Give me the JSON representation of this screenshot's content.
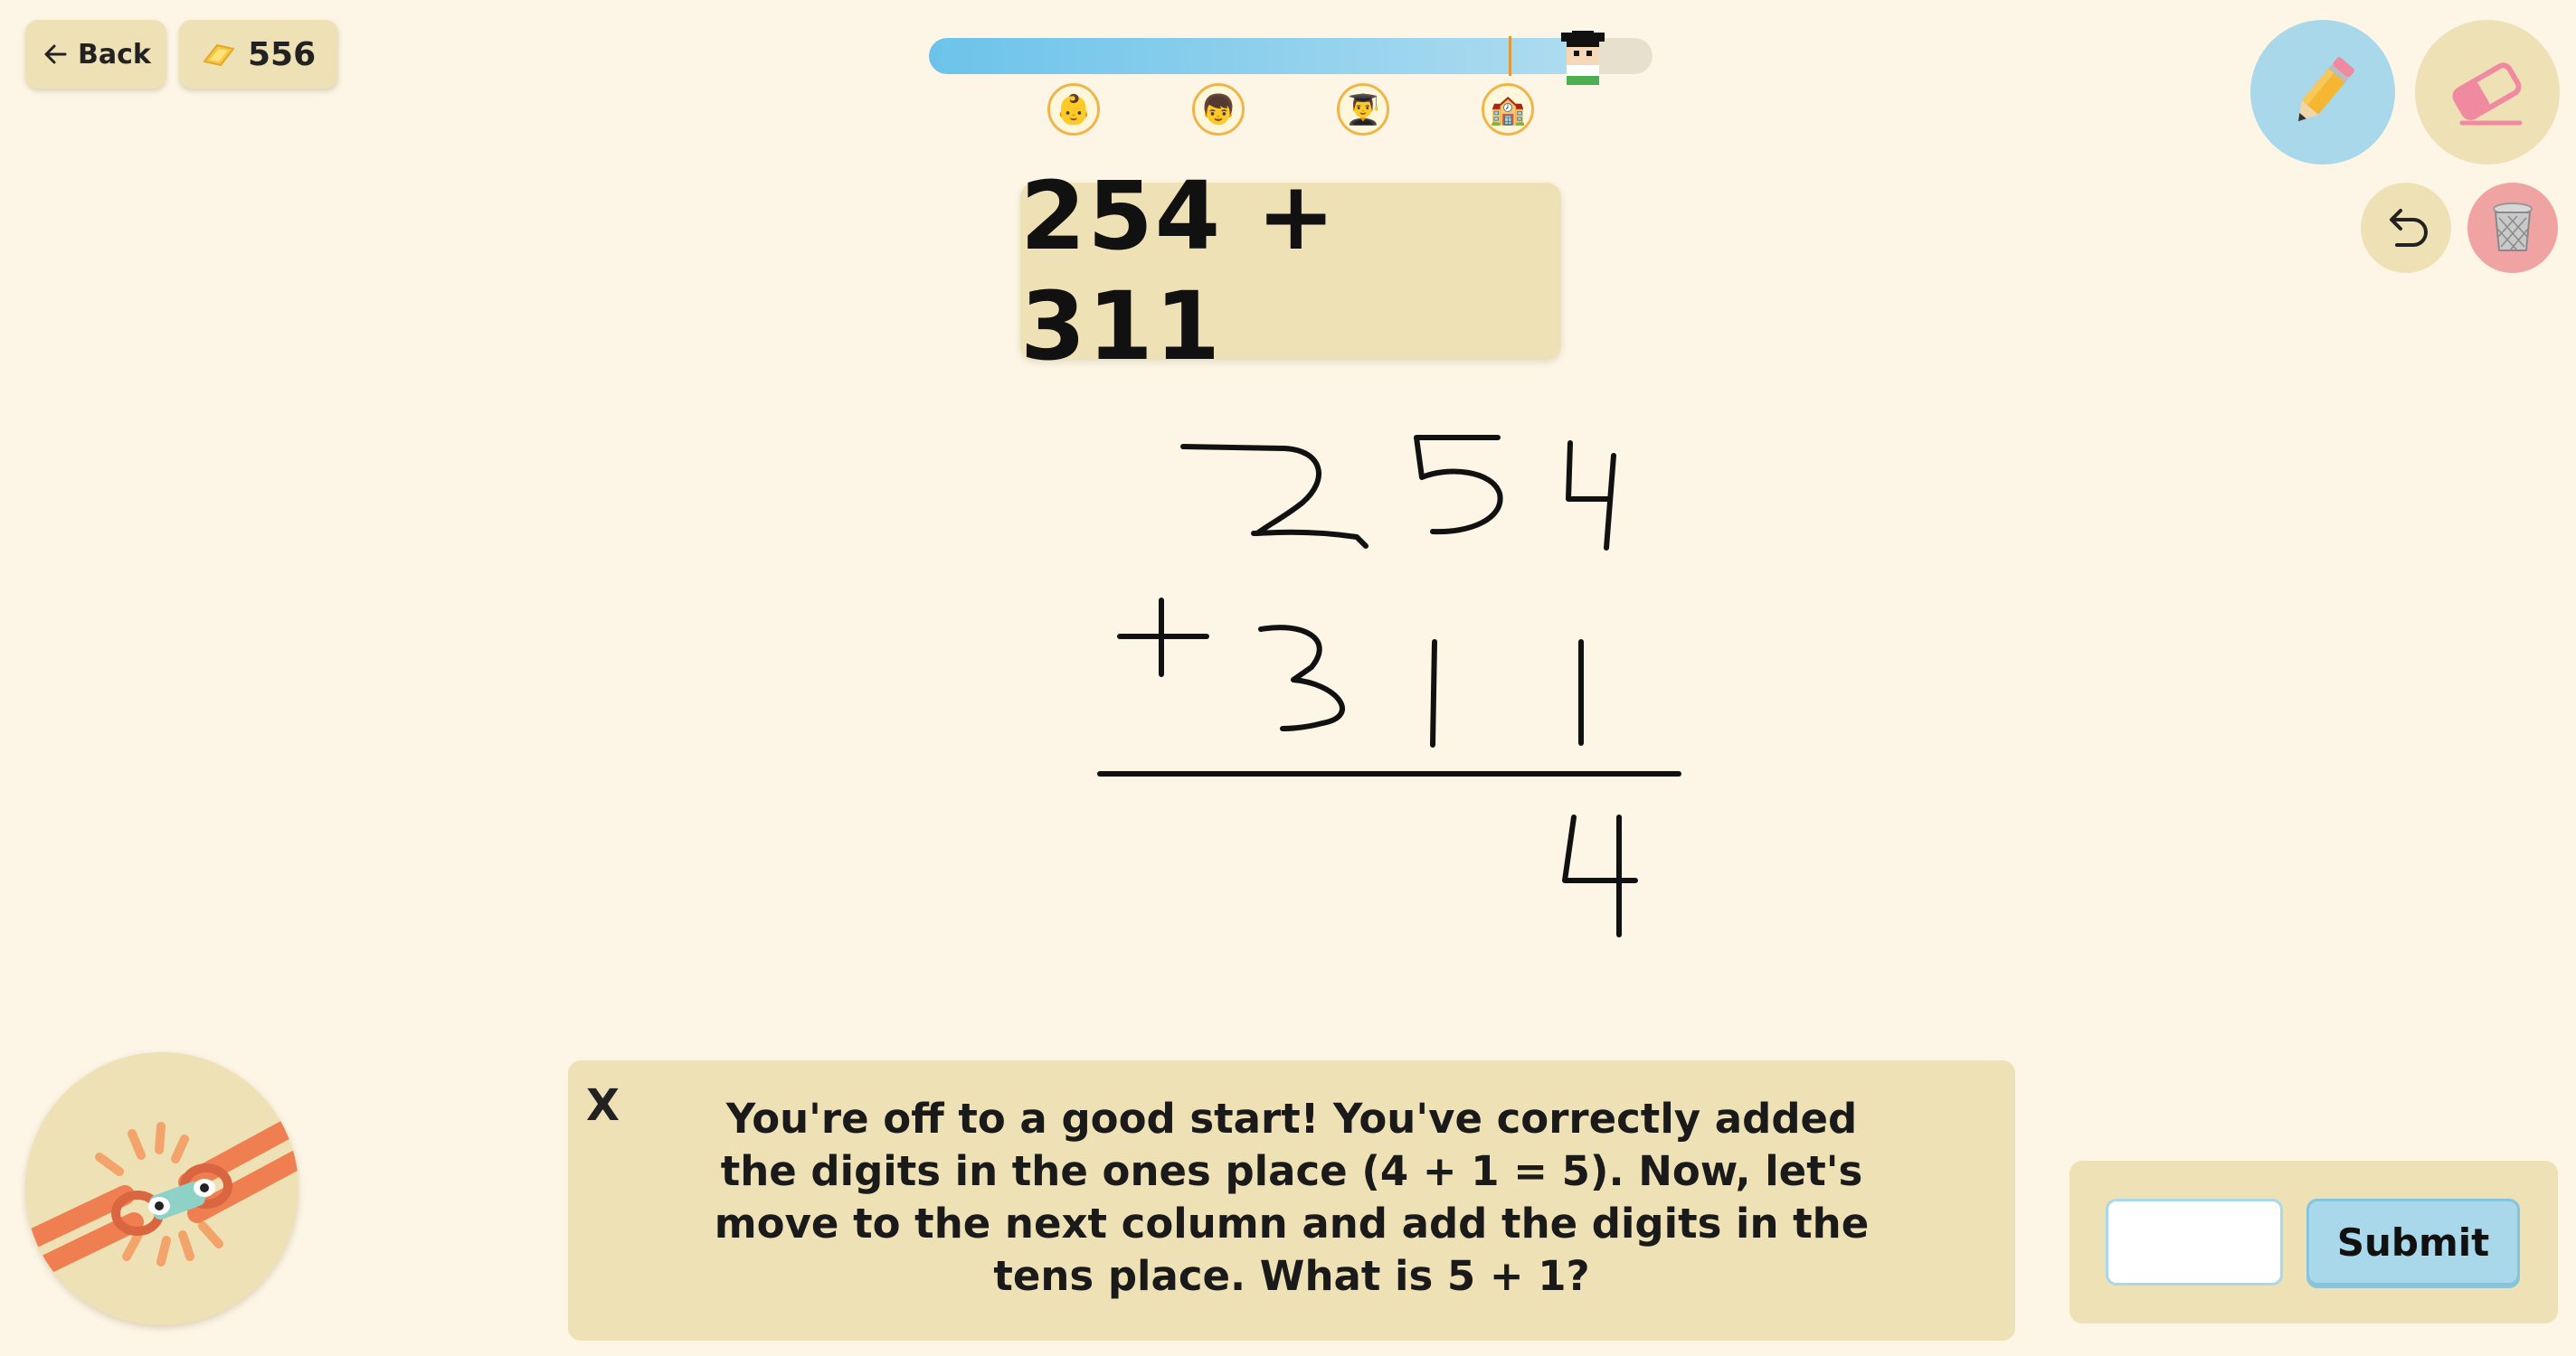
{
  "header": {
    "back_label": "Back",
    "coins": "556"
  },
  "progress": {
    "fraction": 0.9,
    "milestones": [
      "👶",
      "👦",
      "👨‍🎓",
      "🏫"
    ]
  },
  "problem": {
    "expression": "254 + 311"
  },
  "tools": [
    "pencil-icon",
    "eraser-icon",
    "undo-icon",
    "trash-icon"
  ],
  "feedback": {
    "close_label": "X",
    "message": "You're off to a good start! You've correctly added the digits in the ones place (4 + 1 = 5). Now, let's move to the next column and add the digits in the tens place. What is 5 + 1?"
  },
  "answer": {
    "value": "",
    "submit_label": "Submit"
  },
  "colors": {
    "background": "#fdf6e6",
    "card": "#efe1b6",
    "accent_blue": "#a8d8ea",
    "trash_red": "#f0a3a3",
    "progress_fill": "#6cc3ea"
  }
}
